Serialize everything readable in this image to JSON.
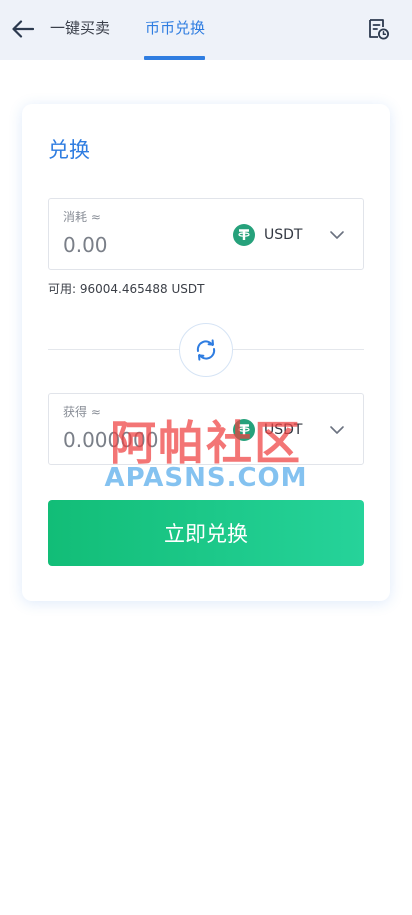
{
  "header": {
    "tabs": [
      {
        "label": "一键买卖",
        "active": false
      },
      {
        "label": "币币兑换",
        "active": true
      }
    ],
    "back_icon": "back-arrow-icon",
    "record_icon": "order-record-icon"
  },
  "card": {
    "title": "兑换",
    "from": {
      "label": "消耗 ≈",
      "placeholder": "0.00",
      "coin": "USDT",
      "coin_icon": "usdt-icon"
    },
    "available": "可用: 96004.465488 USDT",
    "swap_icon": "swap-refresh-icon",
    "to": {
      "label": "获得 ≈",
      "placeholder": "0.000000",
      "coin": "USDT",
      "coin_icon": "usdt-icon"
    },
    "submit_label": "立即兑换"
  },
  "watermark": {
    "cn": "阿帕社区",
    "en": "APASNS.COM"
  },
  "colors": {
    "accent": "#2f7de1",
    "button_start": "#12bd77",
    "button_end": "#26d39a",
    "usdt": "#26a17b",
    "header_bg": "#eef2f9"
  }
}
